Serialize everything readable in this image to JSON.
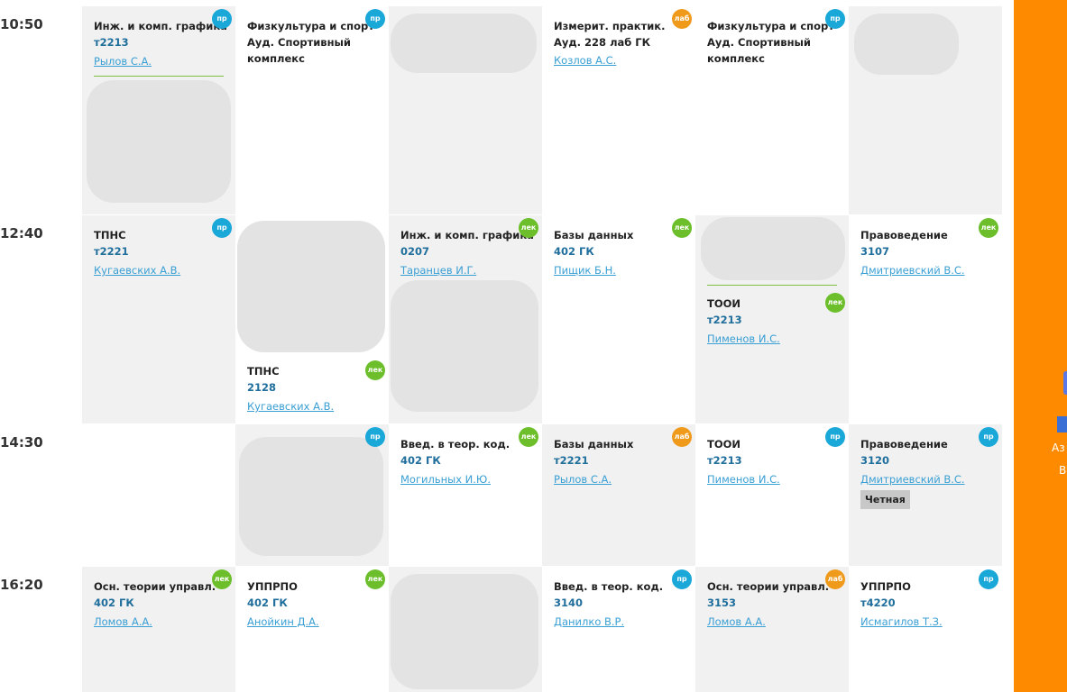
{
  "rows": [
    {
      "time": "10:50",
      "cells": [
        {
          "lessons": [
            {
              "subject": "Инж. и комп. графика",
              "room": "т2213",
              "teacher": "Рылов С.А.",
              "badge": "пр"
            }
          ]
        },
        {
          "lessons": [
            {
              "subject": "Физкультура и спорт",
              "room_line": "Ауд. Спортивный",
              "room_line2": "комплекс",
              "badge": "пр"
            }
          ]
        },
        {
          "lessons": []
        },
        {
          "lessons": [
            {
              "subject": "Измерит. практик.",
              "room_line": "Ауд. 228 лаб ГК",
              "teacher": "Козлов А.С.",
              "badge": "лаб"
            }
          ]
        },
        {
          "lessons": [
            {
              "subject": "Физкультура и спорт",
              "room_line": "Ауд. Спортивный",
              "room_line2": "комплекс",
              "badge": "пр"
            }
          ]
        },
        {
          "lessons": []
        }
      ]
    },
    {
      "time": "12:40",
      "cells": [
        {
          "lessons": [
            {
              "subject": "ТПНС",
              "room": "т2221",
              "teacher": "Кугаевских А.В.",
              "badge": "пр"
            }
          ]
        },
        {
          "lessons": [
            {
              "subject": "ТПНС",
              "room": "2128",
              "teacher": "Кугаевских А.В.",
              "badge": "лек"
            }
          ]
        },
        {
          "lessons": [
            {
              "subject": "Инж. и комп. графика",
              "room": "0207",
              "teacher": "Таранцев И.Г.",
              "badge": "лек"
            }
          ]
        },
        {
          "lessons": [
            {
              "subject": "Базы данных",
              "room": "402 ГК",
              "teacher": "Пищик Б.Н.",
              "badge": "лек"
            }
          ]
        },
        {
          "lessons": [
            {
              "subject": "ТООИ",
              "room": "т2213",
              "teacher": "Пименов И.С.",
              "badge": "лек"
            }
          ]
        },
        {
          "lessons": [
            {
              "subject": "Правоведение",
              "room": "3107",
              "teacher": "Дмитриевский В.С.",
              "badge": "лек"
            }
          ]
        }
      ]
    },
    {
      "time": "14:30",
      "cells": [
        {
          "lessons": []
        },
        {
          "lessons": [
            {
              "badge": "пр"
            }
          ]
        },
        {
          "lessons": [
            {
              "subject": "Введ. в теор. код.",
              "room": "402 ГК",
              "teacher": "Могильных И.Ю.",
              "badge": "лек"
            }
          ]
        },
        {
          "lessons": [
            {
              "subject": "Базы данных",
              "room": "т2221",
              "teacher": "Рылов С.А.",
              "badge": "лаб"
            }
          ]
        },
        {
          "lessons": [
            {
              "subject": "ТООИ",
              "room": "т2213",
              "teacher": "Пименов И.С.",
              "badge": "пр"
            }
          ]
        },
        {
          "lessons": [
            {
              "subject": "Правоведение",
              "room": "3120",
              "teacher": "Дмитриевский В.С.",
              "badge": "пр",
              "parity": "Четная"
            }
          ]
        }
      ]
    },
    {
      "time": "16:20",
      "cells": [
        {
          "lessons": [
            {
              "subject": "Осн. теории управл.",
              "room": "402 ГК",
              "teacher": "Ломов А.А.",
              "badge": "лек"
            }
          ]
        },
        {
          "lessons": [
            {
              "subject": "УППРПО",
              "room": "402 ГК",
              "teacher": "Анойкин Д.А.",
              "badge": "лек"
            }
          ]
        },
        {
          "lessons": []
        },
        {
          "lessons": [
            {
              "subject": "Введ. в теор. код.",
              "room": "3140",
              "teacher": "Данилко В.Р.",
              "badge": "пр"
            }
          ]
        },
        {
          "lessons": [
            {
              "subject": "Осн. теории управл.",
              "room": "3153",
              "teacher": "Ломов А.А.",
              "badge": "лаб"
            }
          ]
        },
        {
          "lessons": [
            {
              "subject": "УППРПО",
              "room": "т4220",
              "teacher": "Исмагилов Т.З.",
              "badge": "пр"
            }
          ]
        }
      ]
    }
  ],
  "desktop_icon": {
    "label_line1": "Аз",
    "label_line2": "В"
  },
  "colors": {
    "accent": "#fe8a00",
    "pr": "#1aa8d8",
    "lek": "#6cbf2b",
    "lab": "#f09a1c"
  }
}
